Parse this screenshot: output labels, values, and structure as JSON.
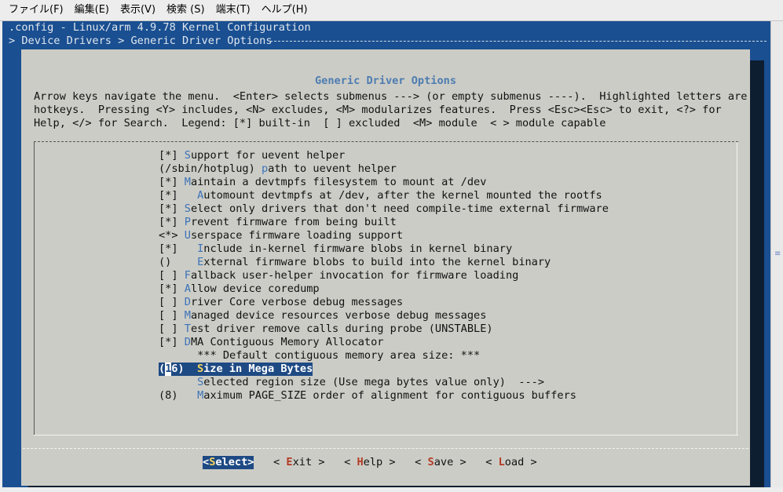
{
  "menubar": [
    "ファイル(F)",
    "編集(E)",
    "表示(V)",
    "検索 (S)",
    "端末(T)",
    "ヘルプ(H)"
  ],
  "terminal": {
    "title_line": ".config - Linux/arm 4.9.78 Kernel Configuration",
    "breadcrumb": "> Device Drivers > Generic Driver Options"
  },
  "dialog": {
    "title": "Generic Driver Options",
    "help_lines": [
      "Arrow keys navigate the menu.  <Enter> selects submenus ---> (or empty submenus ----).  Highlighted letters are",
      "hotkeys.  Pressing <Y> includes, <N> excludes, <M> modularizes features.  Press <Esc><Esc> to exit, <?> for",
      "Help, </> for Search.  Legend: [*] built-in  [ ] excluded  <M> module  < > module capable"
    ],
    "items": [
      {
        "pre": "[*] ",
        "hk": "S",
        "post": "upport for uevent helper"
      },
      {
        "pre": "(/sbin/hotplug) ",
        "hk": "p",
        "post": "ath to uevent helper"
      },
      {
        "pre": "[*] ",
        "hk": "M",
        "post": "aintain a devtmpfs filesystem to mount at /dev"
      },
      {
        "pre": "[*]   ",
        "hk": "A",
        "post": "utomount devtmpfs at /dev, after the kernel mounted the rootfs"
      },
      {
        "pre": "[*] ",
        "hk": "S",
        "post": "elect only drivers that don't need compile-time external firmware"
      },
      {
        "pre": "[*] ",
        "hk": "P",
        "post": "revent firmware from being built"
      },
      {
        "pre": "<*> ",
        "hk": "U",
        "post": "serspace firmware loading support"
      },
      {
        "pre": "[*]   ",
        "hk": "I",
        "post": "nclude in-kernel firmware blobs in kernel binary"
      },
      {
        "pre": "()    ",
        "hk": "E",
        "post": "xternal firmware blobs to build into the kernel binary"
      },
      {
        "pre": "[ ] ",
        "hk": "F",
        "post": "allback user-helper invocation for firmware loading"
      },
      {
        "pre": "[*] ",
        "hk": "A",
        "post": "llow device coredump"
      },
      {
        "pre": "[ ] ",
        "hk": "D",
        "post": "river Core verbose debug messages"
      },
      {
        "pre": "[ ] ",
        "hk": "M",
        "post": "anaged device resources verbose debug messages"
      },
      {
        "pre": "[ ] ",
        "hk": "T",
        "post": "est driver remove calls during probe (UNSTABLE)"
      },
      {
        "pre": "[*] ",
        "hk": "D",
        "post": "MA Contiguous Memory Allocator"
      },
      {
        "pre": "      ",
        "hk": "",
        "post": "*** Default contiguous memory area size: ***"
      },
      {
        "pre": "(16)  ",
        "hk": "S",
        "post": "ize in Mega Bytes",
        "selected": true
      },
      {
        "pre": "      ",
        "hk": "S",
        "post": "elected region size (Use mega bytes value only)  --->"
      },
      {
        "pre": "(8)   ",
        "hk": "M",
        "post": "aximum PAGE_SIZE order of alignment for contiguous buffers"
      }
    ],
    "buttons": [
      {
        "pre": "<",
        "hk": "S",
        "post": "elect>",
        "active": true
      },
      {
        "pre": "< ",
        "hk": "E",
        "post": "xit >"
      },
      {
        "pre": "< ",
        "hk": "H",
        "post": "elp >"
      },
      {
        "pre": "< ",
        "hk": "S",
        "post": "ave >"
      },
      {
        "pre": "< ",
        "hk": "L",
        "post": "oad >"
      }
    ]
  },
  "colors": {
    "terminal_bg": "#1a4f91",
    "dialog_bg": "#ccccc6",
    "highlight": "#1e4a84",
    "hotkey": "#3b73b8"
  }
}
